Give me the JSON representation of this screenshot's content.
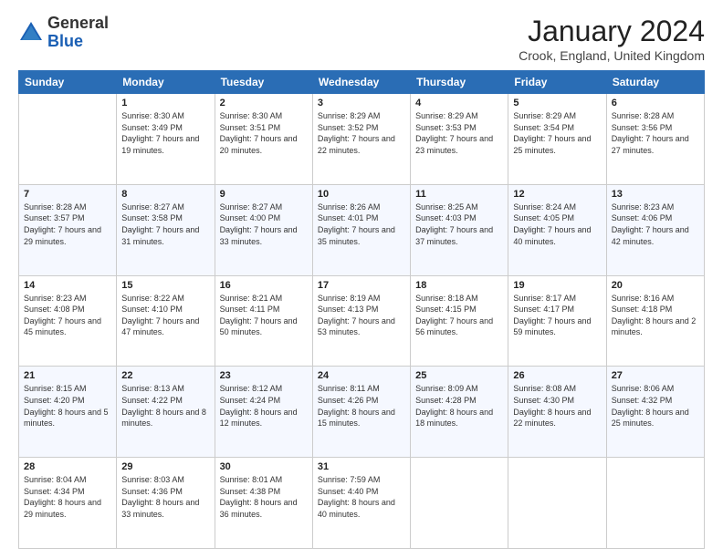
{
  "logo": {
    "general": "General",
    "blue": "Blue"
  },
  "title": "January 2024",
  "location": "Crook, England, United Kingdom",
  "days_of_week": [
    "Sunday",
    "Monday",
    "Tuesday",
    "Wednesday",
    "Thursday",
    "Friday",
    "Saturday"
  ],
  "weeks": [
    [
      {
        "day": "",
        "sunrise": "",
        "sunset": "",
        "daylight": ""
      },
      {
        "day": "1",
        "sunrise": "Sunrise: 8:30 AM",
        "sunset": "Sunset: 3:49 PM",
        "daylight": "Daylight: 7 hours and 19 minutes."
      },
      {
        "day": "2",
        "sunrise": "Sunrise: 8:30 AM",
        "sunset": "Sunset: 3:51 PM",
        "daylight": "Daylight: 7 hours and 20 minutes."
      },
      {
        "day": "3",
        "sunrise": "Sunrise: 8:29 AM",
        "sunset": "Sunset: 3:52 PM",
        "daylight": "Daylight: 7 hours and 22 minutes."
      },
      {
        "day": "4",
        "sunrise": "Sunrise: 8:29 AM",
        "sunset": "Sunset: 3:53 PM",
        "daylight": "Daylight: 7 hours and 23 minutes."
      },
      {
        "day": "5",
        "sunrise": "Sunrise: 8:29 AM",
        "sunset": "Sunset: 3:54 PM",
        "daylight": "Daylight: 7 hours and 25 minutes."
      },
      {
        "day": "6",
        "sunrise": "Sunrise: 8:28 AM",
        "sunset": "Sunset: 3:56 PM",
        "daylight": "Daylight: 7 hours and 27 minutes."
      }
    ],
    [
      {
        "day": "7",
        "sunrise": "Sunrise: 8:28 AM",
        "sunset": "Sunset: 3:57 PM",
        "daylight": "Daylight: 7 hours and 29 minutes."
      },
      {
        "day": "8",
        "sunrise": "Sunrise: 8:27 AM",
        "sunset": "Sunset: 3:58 PM",
        "daylight": "Daylight: 7 hours and 31 minutes."
      },
      {
        "day": "9",
        "sunrise": "Sunrise: 8:27 AM",
        "sunset": "Sunset: 4:00 PM",
        "daylight": "Daylight: 7 hours and 33 minutes."
      },
      {
        "day": "10",
        "sunrise": "Sunrise: 8:26 AM",
        "sunset": "Sunset: 4:01 PM",
        "daylight": "Daylight: 7 hours and 35 minutes."
      },
      {
        "day": "11",
        "sunrise": "Sunrise: 8:25 AM",
        "sunset": "Sunset: 4:03 PM",
        "daylight": "Daylight: 7 hours and 37 minutes."
      },
      {
        "day": "12",
        "sunrise": "Sunrise: 8:24 AM",
        "sunset": "Sunset: 4:05 PM",
        "daylight": "Daylight: 7 hours and 40 minutes."
      },
      {
        "day": "13",
        "sunrise": "Sunrise: 8:23 AM",
        "sunset": "Sunset: 4:06 PM",
        "daylight": "Daylight: 7 hours and 42 minutes."
      }
    ],
    [
      {
        "day": "14",
        "sunrise": "Sunrise: 8:23 AM",
        "sunset": "Sunset: 4:08 PM",
        "daylight": "Daylight: 7 hours and 45 minutes."
      },
      {
        "day": "15",
        "sunrise": "Sunrise: 8:22 AM",
        "sunset": "Sunset: 4:10 PM",
        "daylight": "Daylight: 7 hours and 47 minutes."
      },
      {
        "day": "16",
        "sunrise": "Sunrise: 8:21 AM",
        "sunset": "Sunset: 4:11 PM",
        "daylight": "Daylight: 7 hours and 50 minutes."
      },
      {
        "day": "17",
        "sunrise": "Sunrise: 8:19 AM",
        "sunset": "Sunset: 4:13 PM",
        "daylight": "Daylight: 7 hours and 53 minutes."
      },
      {
        "day": "18",
        "sunrise": "Sunrise: 8:18 AM",
        "sunset": "Sunset: 4:15 PM",
        "daylight": "Daylight: 7 hours and 56 minutes."
      },
      {
        "day": "19",
        "sunrise": "Sunrise: 8:17 AM",
        "sunset": "Sunset: 4:17 PM",
        "daylight": "Daylight: 7 hours and 59 minutes."
      },
      {
        "day": "20",
        "sunrise": "Sunrise: 8:16 AM",
        "sunset": "Sunset: 4:18 PM",
        "daylight": "Daylight: 8 hours and 2 minutes."
      }
    ],
    [
      {
        "day": "21",
        "sunrise": "Sunrise: 8:15 AM",
        "sunset": "Sunset: 4:20 PM",
        "daylight": "Daylight: 8 hours and 5 minutes."
      },
      {
        "day": "22",
        "sunrise": "Sunrise: 8:13 AM",
        "sunset": "Sunset: 4:22 PM",
        "daylight": "Daylight: 8 hours and 8 minutes."
      },
      {
        "day": "23",
        "sunrise": "Sunrise: 8:12 AM",
        "sunset": "Sunset: 4:24 PM",
        "daylight": "Daylight: 8 hours and 12 minutes."
      },
      {
        "day": "24",
        "sunrise": "Sunrise: 8:11 AM",
        "sunset": "Sunset: 4:26 PM",
        "daylight": "Daylight: 8 hours and 15 minutes."
      },
      {
        "day": "25",
        "sunrise": "Sunrise: 8:09 AM",
        "sunset": "Sunset: 4:28 PM",
        "daylight": "Daylight: 8 hours and 18 minutes."
      },
      {
        "day": "26",
        "sunrise": "Sunrise: 8:08 AM",
        "sunset": "Sunset: 4:30 PM",
        "daylight": "Daylight: 8 hours and 22 minutes."
      },
      {
        "day": "27",
        "sunrise": "Sunrise: 8:06 AM",
        "sunset": "Sunset: 4:32 PM",
        "daylight": "Daylight: 8 hours and 25 minutes."
      }
    ],
    [
      {
        "day": "28",
        "sunrise": "Sunrise: 8:04 AM",
        "sunset": "Sunset: 4:34 PM",
        "daylight": "Daylight: 8 hours and 29 minutes."
      },
      {
        "day": "29",
        "sunrise": "Sunrise: 8:03 AM",
        "sunset": "Sunset: 4:36 PM",
        "daylight": "Daylight: 8 hours and 33 minutes."
      },
      {
        "day": "30",
        "sunrise": "Sunrise: 8:01 AM",
        "sunset": "Sunset: 4:38 PM",
        "daylight": "Daylight: 8 hours and 36 minutes."
      },
      {
        "day": "31",
        "sunrise": "Sunrise: 7:59 AM",
        "sunset": "Sunset: 4:40 PM",
        "daylight": "Daylight: 8 hours and 40 minutes."
      },
      {
        "day": "",
        "sunrise": "",
        "sunset": "",
        "daylight": ""
      },
      {
        "day": "",
        "sunrise": "",
        "sunset": "",
        "daylight": ""
      },
      {
        "day": "",
        "sunrise": "",
        "sunset": "",
        "daylight": ""
      }
    ]
  ]
}
